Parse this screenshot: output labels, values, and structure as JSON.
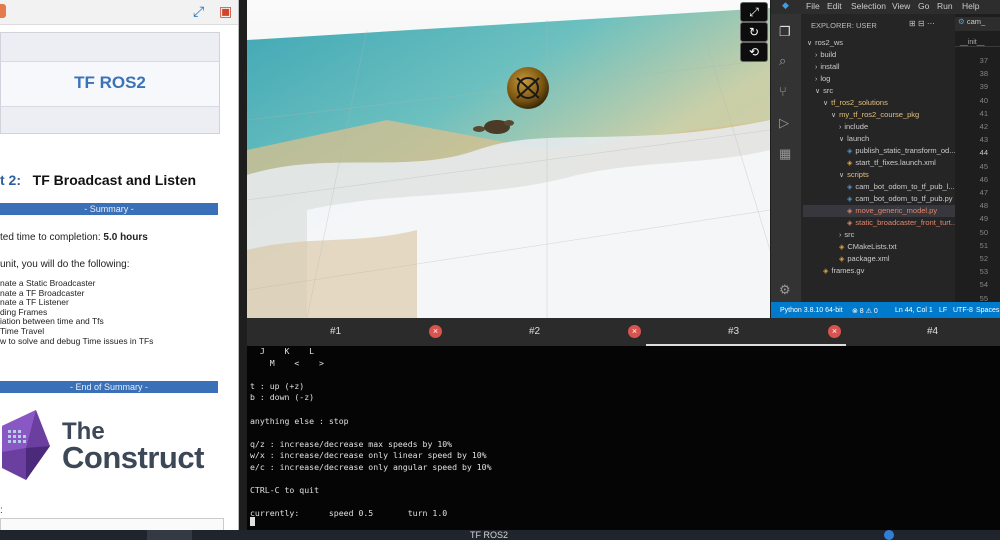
{
  "left_panel": {
    "title": "TF ROS2",
    "unit_number": "t 2:",
    "unit_title": "TF Broadcast and Listen",
    "summary_header": "- Summary -",
    "completion_label": "ted time to completion: ",
    "completion_value": "5.0 hours",
    "intro": "unit, you will do the following:",
    "objectives": [
      "nate a Static Broadcaster",
      "nate a TF Broadcaster",
      "nate a TF Listener",
      "ding Frames",
      "iation between time and Tfs",
      " Time Travel",
      "w to solve and debug Time issues in TFs"
    ],
    "summary_footer": "- End of Summary -",
    "logo_the": "The",
    "logo_construct": "Construct",
    "colon_text": ":"
  },
  "scene_controls": {
    "fullscreen_icon": "expand-arrows-icon",
    "rotate_icon": "rotate-icon",
    "reset_icon": "refresh-icon"
  },
  "vscode": {
    "menu": [
      "File",
      "Edit",
      "Selection",
      "View",
      "Go",
      "Run",
      "Help"
    ],
    "explorer_title": "EXPLORER: USER",
    "tree": [
      {
        "label": "ros2_ws",
        "indent": 0,
        "kind": "folder-open"
      },
      {
        "label": "build",
        "indent": 1,
        "kind": "folder"
      },
      {
        "label": "install",
        "indent": 1,
        "kind": "folder"
      },
      {
        "label": "log",
        "indent": 1,
        "kind": "folder"
      },
      {
        "label": "src",
        "indent": 1,
        "kind": "folder-open"
      },
      {
        "label": "tf_ros2_solutions",
        "indent": 2,
        "kind": "folder-open",
        "active": true
      },
      {
        "label": "my_tf_ros2_course_pkg",
        "indent": 3,
        "kind": "folder-open",
        "active": true
      },
      {
        "label": "include",
        "indent": 4,
        "kind": "folder"
      },
      {
        "label": "launch",
        "indent": 4,
        "kind": "folder-open"
      },
      {
        "label": "publish_static_transform_od...",
        "indent": 5,
        "kind": "file-blue"
      },
      {
        "label": "start_tf_fixes.launch.xml",
        "indent": 5,
        "kind": "file"
      },
      {
        "label": "scripts",
        "indent": 4,
        "kind": "folder-open",
        "active": true
      },
      {
        "label": "cam_bot_odom_to_tf_pub_l...",
        "indent": 5,
        "kind": "file-blue"
      },
      {
        "label": "cam_bot_odom_to_tf_pub.py",
        "indent": 5,
        "kind": "file-blue"
      },
      {
        "label": "move_generic_model.py",
        "indent": 5,
        "kind": "file-mod",
        "selected": true
      },
      {
        "label": "static_broadcaster_front_turt...",
        "indent": 5,
        "kind": "file-mod"
      },
      {
        "label": "src",
        "indent": 4,
        "kind": "folder"
      },
      {
        "label": "CMakeLists.txt",
        "indent": 4,
        "kind": "file"
      },
      {
        "label": "package.xml",
        "indent": 4,
        "kind": "file"
      },
      {
        "label": "frames.gv",
        "indent": 2,
        "kind": "file"
      }
    ],
    "editor_tab": "cam_",
    "breadcrumb": "__init__",
    "line_numbers": [
      "37",
      "38",
      "39",
      "40",
      "41",
      "42",
      "43",
      "44",
      "45",
      "46",
      "47",
      "48",
      "49",
      "50",
      "51",
      "52",
      "53",
      "54",
      "55"
    ],
    "current_line": "44",
    "status": {
      "python": "Python 3.8.10 64-bit",
      "problems": "⊗ 8 ⚠ 0",
      "position": "Ln 44, Col 1",
      "eol": "LF",
      "encoding": "UTF-8",
      "spaces": "Spaces"
    }
  },
  "terminal": {
    "tabs": [
      "#1",
      "#2",
      "#3",
      "#4"
    ],
    "active_tab_index": 2,
    "lines": [
      "  J    K    L",
      "    M    <    >",
      "",
      "t : up (+z)",
      "b : down (-z)",
      "",
      "anything else : stop",
      "",
      "q/z : increase/decrease max speeds by 10%",
      "w/x : increase/decrease only linear speed by 10%",
      "e/c : increase/decrease only angular speed by 10%",
      "",
      "CTRL-C to quit",
      "",
      "currently:      speed 0.5       turn 1.0"
    ]
  },
  "taskbar": {
    "title": "TF ROS2"
  }
}
